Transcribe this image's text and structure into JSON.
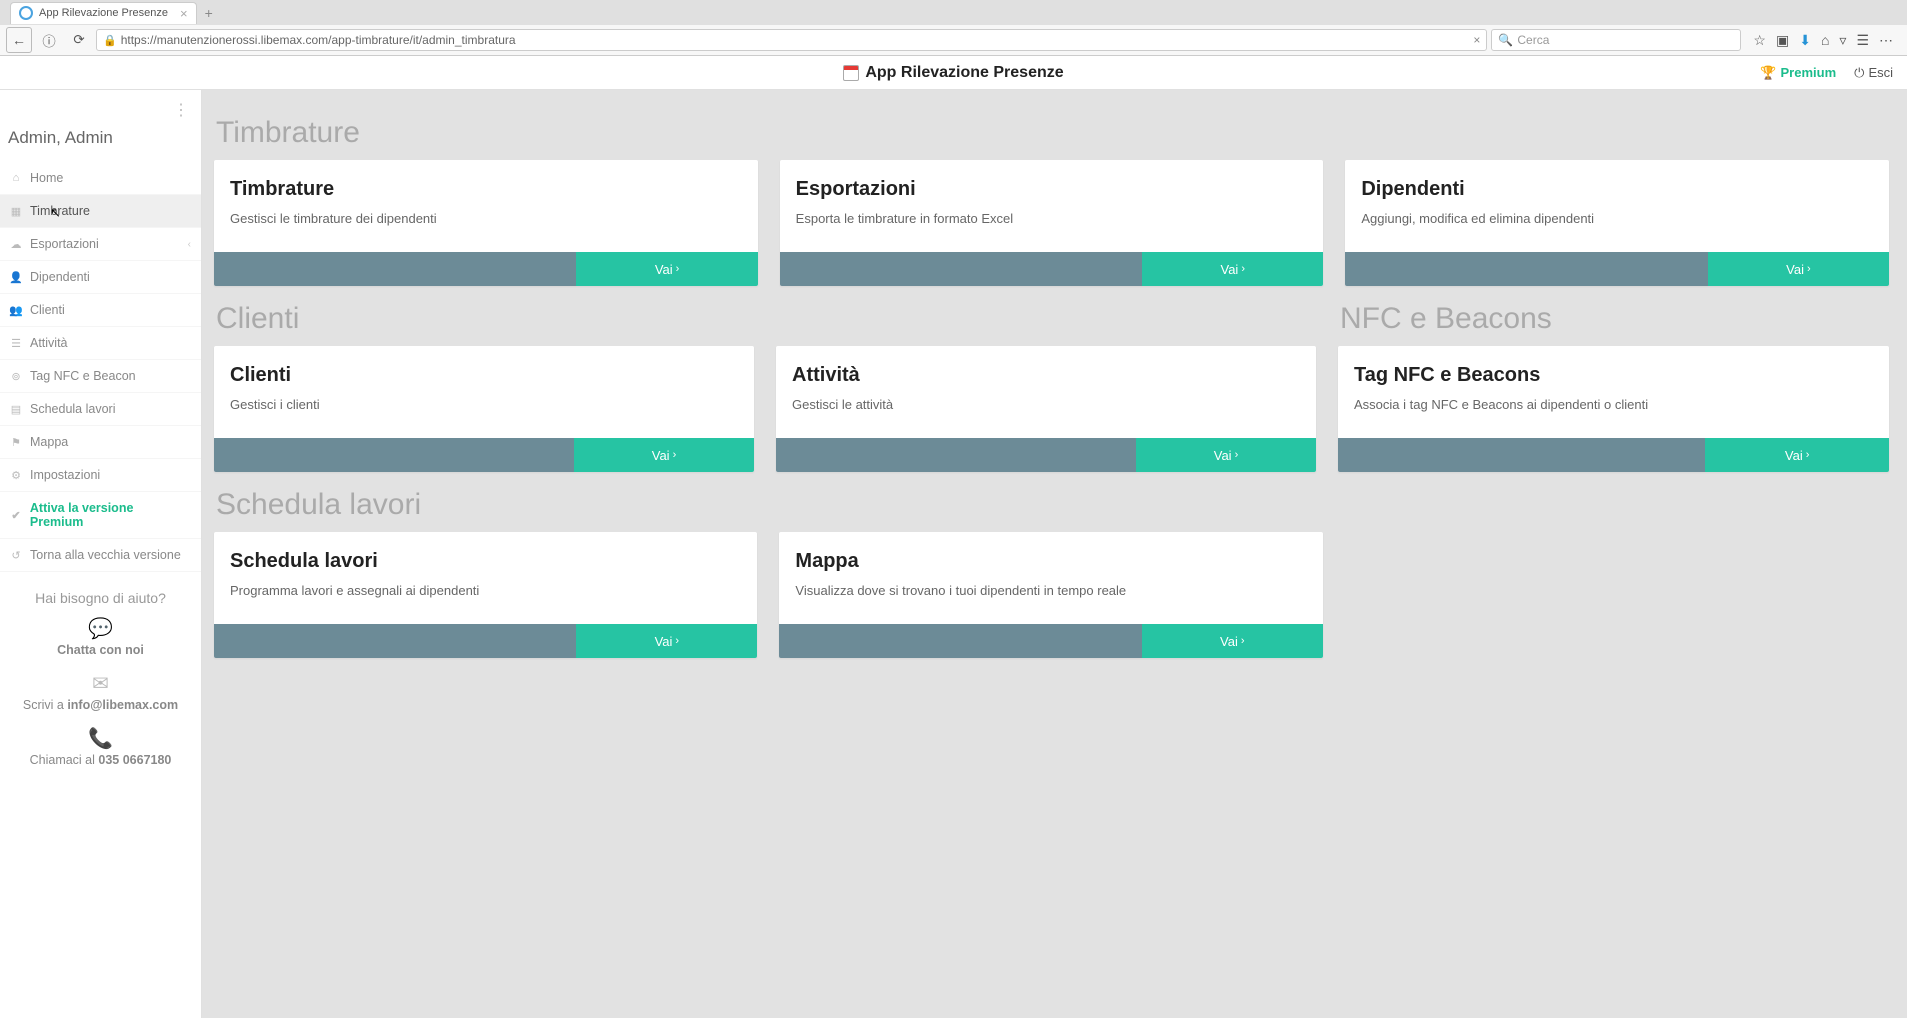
{
  "browser": {
    "tab_title": "App Rilevazione Presenze",
    "url_prefix_info": "ⓘ",
    "url": "https://manutenzionerossi.libemax.com/app-timbrature/it/admin_timbratura",
    "search_placeholder": "Cerca"
  },
  "header": {
    "app_title": "App Rilevazione Presenze",
    "premium_label": "Premium",
    "exit_label": "Esci"
  },
  "sidebar": {
    "user": "Admin, Admin",
    "items": [
      {
        "label": "Home",
        "icon": "⌂"
      },
      {
        "label": "Timbrature",
        "icon": "▦"
      },
      {
        "label": "Esportazioni",
        "icon": "☁",
        "expandable": true
      },
      {
        "label": "Dipendenti",
        "icon": "👤"
      },
      {
        "label": "Clienti",
        "icon": "👥"
      },
      {
        "label": "Attività",
        "icon": "☰"
      },
      {
        "label": "Tag NFC e Beacon",
        "icon": "⊚"
      },
      {
        "label": "Schedula lavori",
        "icon": "▤"
      },
      {
        "label": "Mappa",
        "icon": "⚑"
      },
      {
        "label": "Impostazioni",
        "icon": "⚙"
      },
      {
        "label": "Attiva la versione Premium",
        "icon": "✔"
      },
      {
        "label": "Torna alla vecchia versione",
        "icon": "↺"
      }
    ],
    "help": {
      "title": "Hai bisogno di aiuto?",
      "chat_label": "Chatta con noi",
      "write_prefix": "Scrivi a ",
      "email": "info@libemax.com",
      "call_prefix": "Chiamaci al ",
      "phone": "035 0667180"
    }
  },
  "sections": {
    "timbrature_title": "Timbrature",
    "clienti_title": "Clienti",
    "nfc_title": "NFC e Beacons",
    "schedula_title": "Schedula lavori"
  },
  "cards": {
    "vai_label": "Vai",
    "timbrature": {
      "title": "Timbrature",
      "desc": "Gestisci le timbrature dei dipendenti"
    },
    "esportazioni": {
      "title": "Esportazioni",
      "desc": "Esporta le timbrature in formato Excel"
    },
    "dipendenti": {
      "title": "Dipendenti",
      "desc": "Aggiungi, modifica ed elimina dipendenti"
    },
    "clienti": {
      "title": "Clienti",
      "desc": "Gestisci i clienti"
    },
    "attivita": {
      "title": "Attività",
      "desc": "Gestisci le attività"
    },
    "nfc": {
      "title": "Tag NFC e Beacons",
      "desc": "Associa i tag NFC e Beacons ai dipendenti o clienti"
    },
    "schedula": {
      "title": "Schedula lavori",
      "desc": "Programma lavori e assegnali ai dipendenti"
    },
    "mappa": {
      "title": "Mappa",
      "desc": "Visualizza dove si trovano i tuoi dipendenti in tempo reale"
    }
  }
}
